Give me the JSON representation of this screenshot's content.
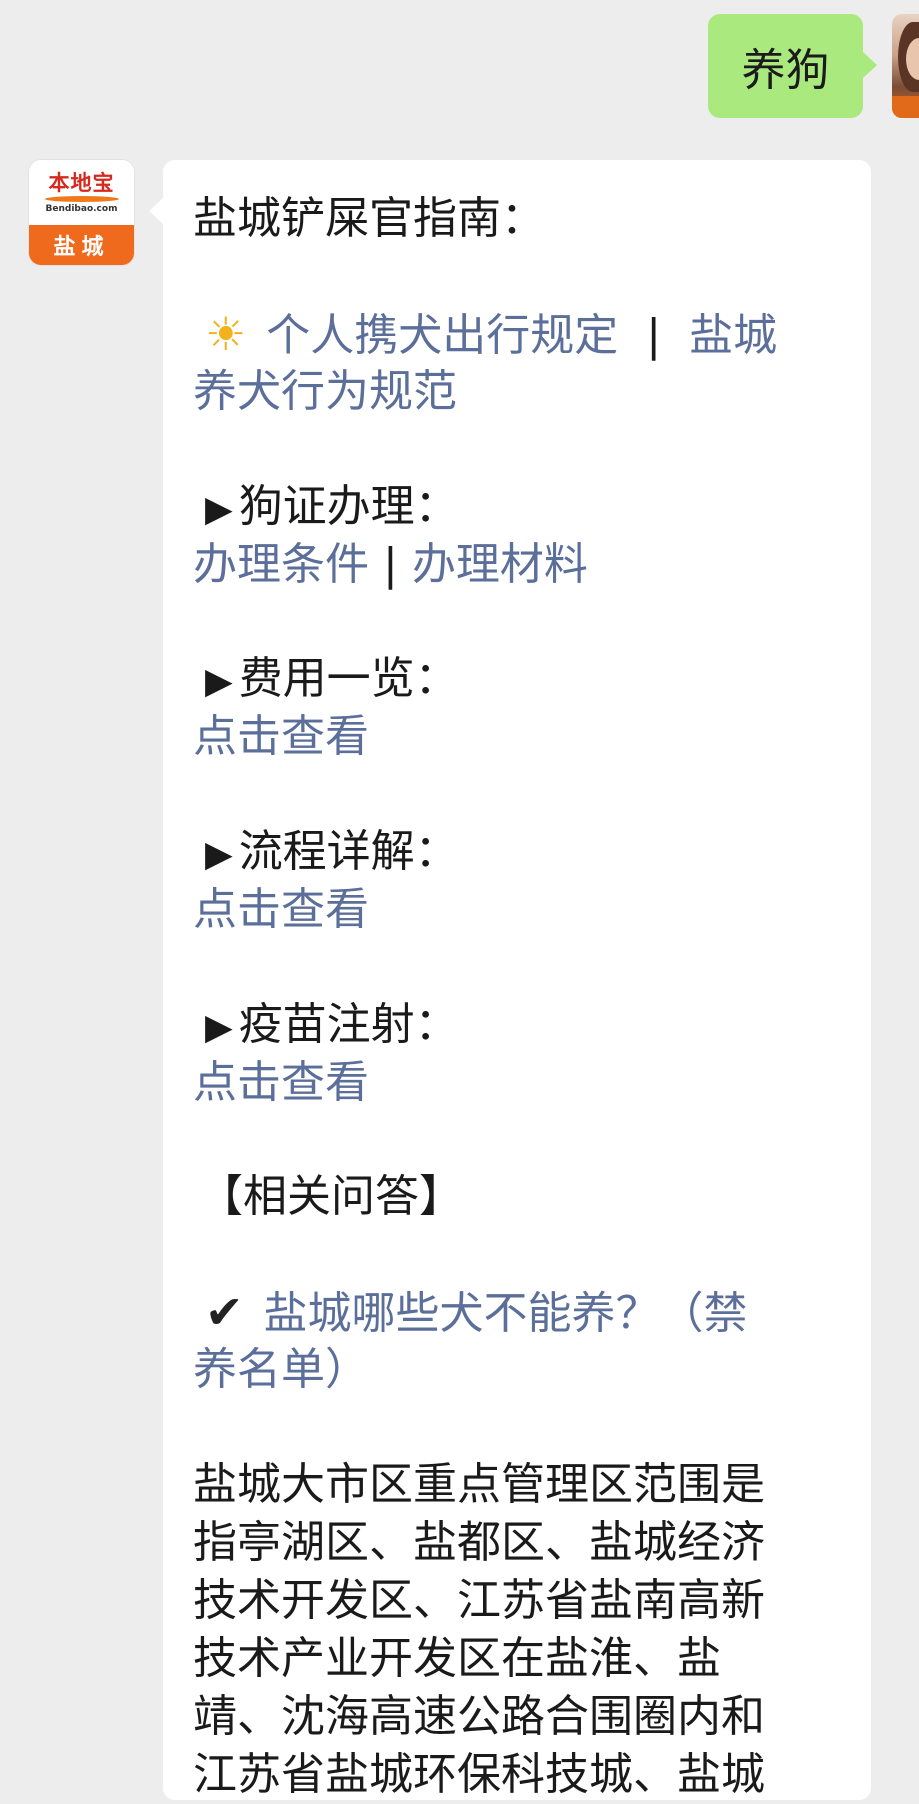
{
  "outgoing": {
    "text": "养狗"
  },
  "bot": {
    "logo_main": "本地宝",
    "logo_url": "Bendibao.com",
    "logo_city": "盐城"
  },
  "message": {
    "title": "盐城铲屎官指南：",
    "rules": {
      "link1": "个人携犬出行规定",
      "separator": "|",
      "link2_part1": "盐城",
      "link2_part2": "养犬行为规范"
    },
    "license": {
      "heading": "狗证办理：",
      "link1": "办理条件",
      "separator": "|",
      "link2": "办理材料"
    },
    "fees": {
      "heading": "费用一览：",
      "link": "点击查看"
    },
    "process": {
      "heading": "流程详解：",
      "link": "点击查看"
    },
    "vaccine": {
      "heading": "疫苗注射：",
      "link": "点击查看"
    },
    "qa_heading": "【相关问答】",
    "qa_link_part1": "盐城哪些犬不能养？（禁",
    "qa_link_part2": "养名单）",
    "body_lines": [
      "盐城大市区重点管理区范围是",
      "指亭湖区、盐都区、盐城经济",
      "技术开发区、江苏省盐南高新",
      "技术产业开发区在盐淮、盐",
      "靖、沈海高速公路合围圈内和",
      "江苏省盐城环保科技城、盐城"
    ]
  }
}
